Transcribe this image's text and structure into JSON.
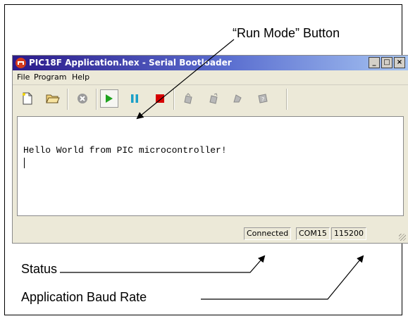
{
  "callouts": {
    "run_mode": "“Run Mode” Button",
    "status": "Status",
    "baud": "Application Baud Rate"
  },
  "window": {
    "title": "PIC18F Application.hex - Serial Bootloader",
    "controls": {
      "minimize": "_",
      "maximize": "□",
      "close": "×"
    }
  },
  "menu": [
    "File",
    "Program",
    "Help"
  ],
  "toolbar": {
    "buttons": [
      {
        "name": "new-file-icon"
      },
      {
        "name": "open-folder-icon"
      },
      {
        "name": "abort-icon"
      },
      {
        "name": "run-icon"
      },
      {
        "name": "pause-icon"
      },
      {
        "name": "stop-icon"
      },
      {
        "name": "write-icon"
      },
      {
        "name": "erase-icon"
      },
      {
        "name": "verify-icon"
      },
      {
        "name": "help-icon"
      }
    ]
  },
  "output": {
    "text": "Hello World from PIC microcontroller!"
  },
  "status": {
    "state": "Connected",
    "port": "COM15",
    "baud": "115200"
  },
  "colors": {
    "run": "#1fa21f",
    "pause": "#1aa0c8",
    "stop": "#d60000",
    "title_start": "#2b1a8a",
    "title_end": "#a6c4f2"
  }
}
